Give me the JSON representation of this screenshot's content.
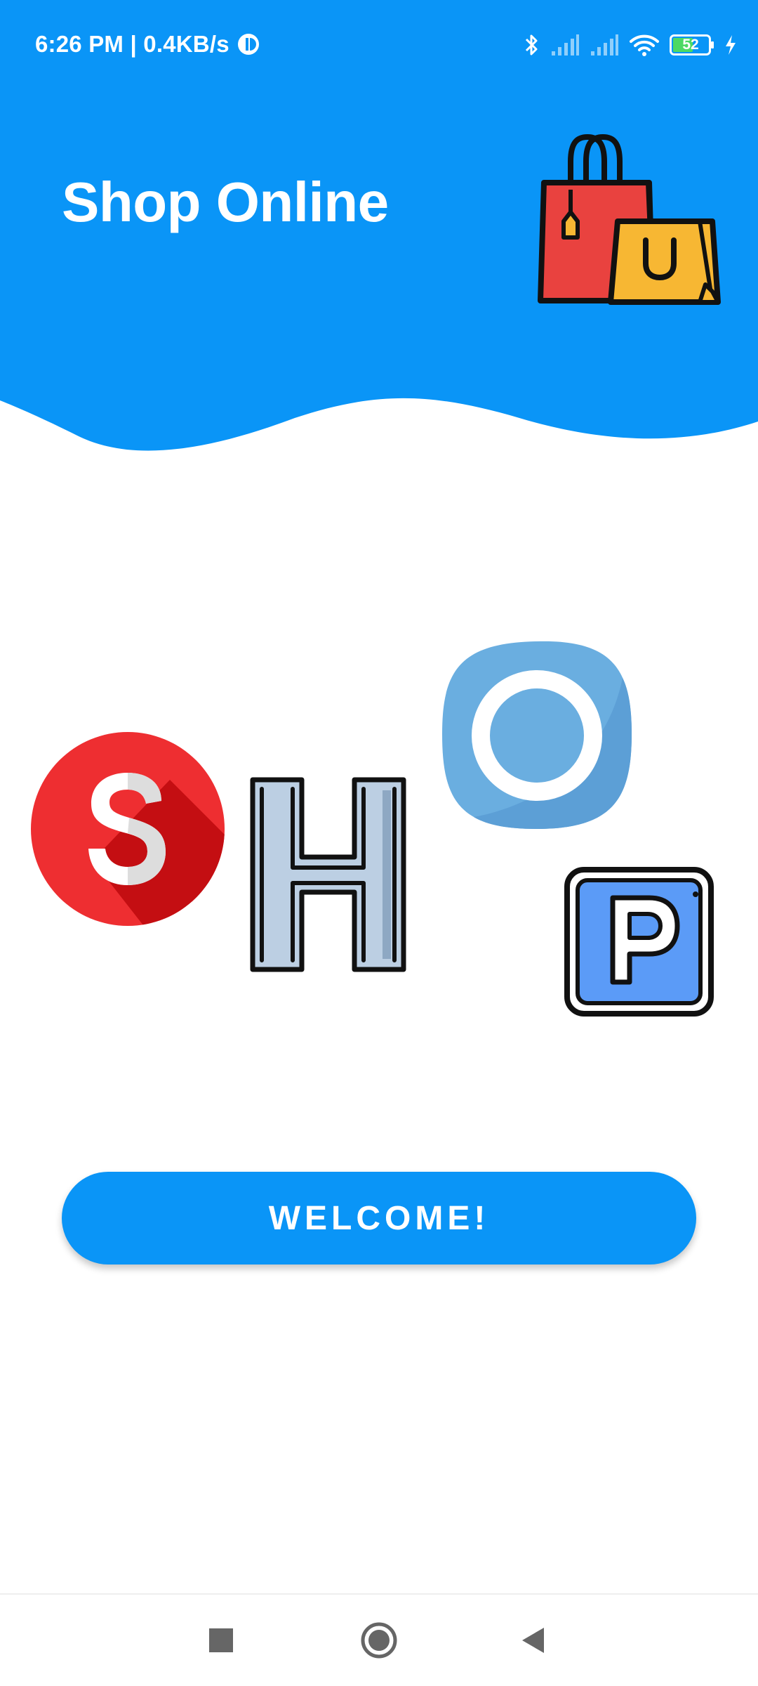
{
  "status_bar": {
    "time_speed": "6:26 PM | 0.4KB/s",
    "battery_level": "52",
    "icons": [
      "data-saver-icon",
      "bluetooth-icon",
      "signal-icon",
      "signal-icon",
      "wifi-icon",
      "battery-icon",
      "charging-icon"
    ]
  },
  "header": {
    "title": "Shop Online",
    "logo_icon": "shopping-bags-icon"
  },
  "shop_letters": [
    {
      "letter": "S",
      "icon": "letter-s-circle-icon"
    },
    {
      "letter": "H",
      "icon": "letter-h-icon"
    },
    {
      "letter": "O",
      "icon": "letter-o-icon"
    },
    {
      "letter": "P",
      "icon": "letter-p-square-icon"
    }
  ],
  "welcome_button": {
    "label": "WELCOME!"
  },
  "nav_bar": {
    "icons": [
      "recents-square-icon",
      "home-circle-icon",
      "back-triangle-icon"
    ]
  },
  "colors": {
    "primary": "#0a95f7",
    "background": "#ffffff",
    "bag_red": "#e9423f",
    "bag_yellow": "#f7b733",
    "s_red": "#ee2e31",
    "h_fill": "#bccfe3",
    "o_blue": "#6aaee0",
    "p_blue": "#5b9bf7"
  }
}
